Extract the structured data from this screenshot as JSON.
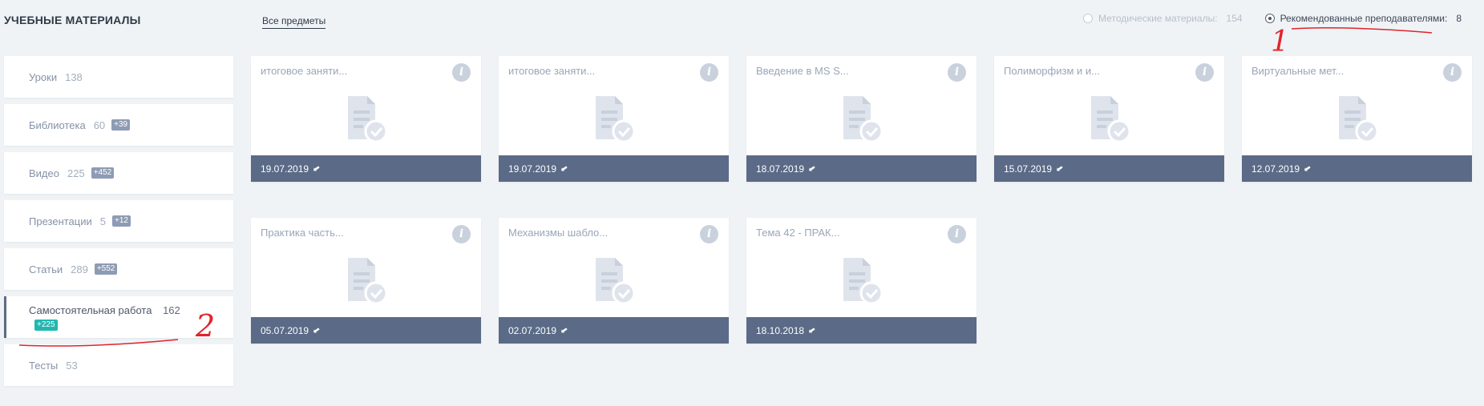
{
  "header": {
    "title": "УЧЕБНЫЕ МАТЕРИАЛЫ",
    "subjects_link": "Все предметы"
  },
  "filters": [
    {
      "label": "Методические материалы:",
      "count": "154",
      "checked": false
    },
    {
      "label": "Рекомендованные преподавателями:",
      "count": "8",
      "checked": true
    }
  ],
  "sidebar": {
    "items": [
      {
        "label": "Уроки",
        "count": "138",
        "badge": ""
      },
      {
        "label": "Библиотека",
        "count": "60",
        "badge": "+39"
      },
      {
        "label": "Видео",
        "count": "225",
        "badge": "+452"
      },
      {
        "label": "Презентации",
        "count": "5",
        "badge": "+12"
      },
      {
        "label": "Статьи",
        "count": "289",
        "badge": "+552"
      },
      {
        "label": "Самостоятельная работа",
        "count": "162",
        "badge": "+225"
      },
      {
        "label": "Тесты",
        "count": "53",
        "badge": ""
      }
    ]
  },
  "cards": [
    {
      "title": "итоговое заняти...",
      "date": "19.07.2019"
    },
    {
      "title": "итоговое заняти...",
      "date": "19.07.2019"
    },
    {
      "title": "Введение в MS S...",
      "date": "18.07.2019"
    },
    {
      "title": "Полиморфизм и и...",
      "date": "15.07.2019"
    },
    {
      "title": "Виртуальные мет...",
      "date": "12.07.2019"
    },
    {
      "title": "Практика часть...",
      "date": "05.07.2019"
    },
    {
      "title": "Механизмы шабло...",
      "date": "02.07.2019"
    },
    {
      "title": "Тема 42 - ПРАК...",
      "date": "18.10.2018"
    }
  ],
  "colors": {
    "card_footer": "#5a6a87",
    "badge": "#8e9bb4",
    "badge_active": "#21b7b0",
    "annotation": "#e0242b"
  },
  "icons": {
    "info": "info-icon",
    "document": "document-check-icon",
    "download": "download-arrow-icon"
  },
  "annotations": {
    "mark_1": "1",
    "mark_2": "2"
  }
}
